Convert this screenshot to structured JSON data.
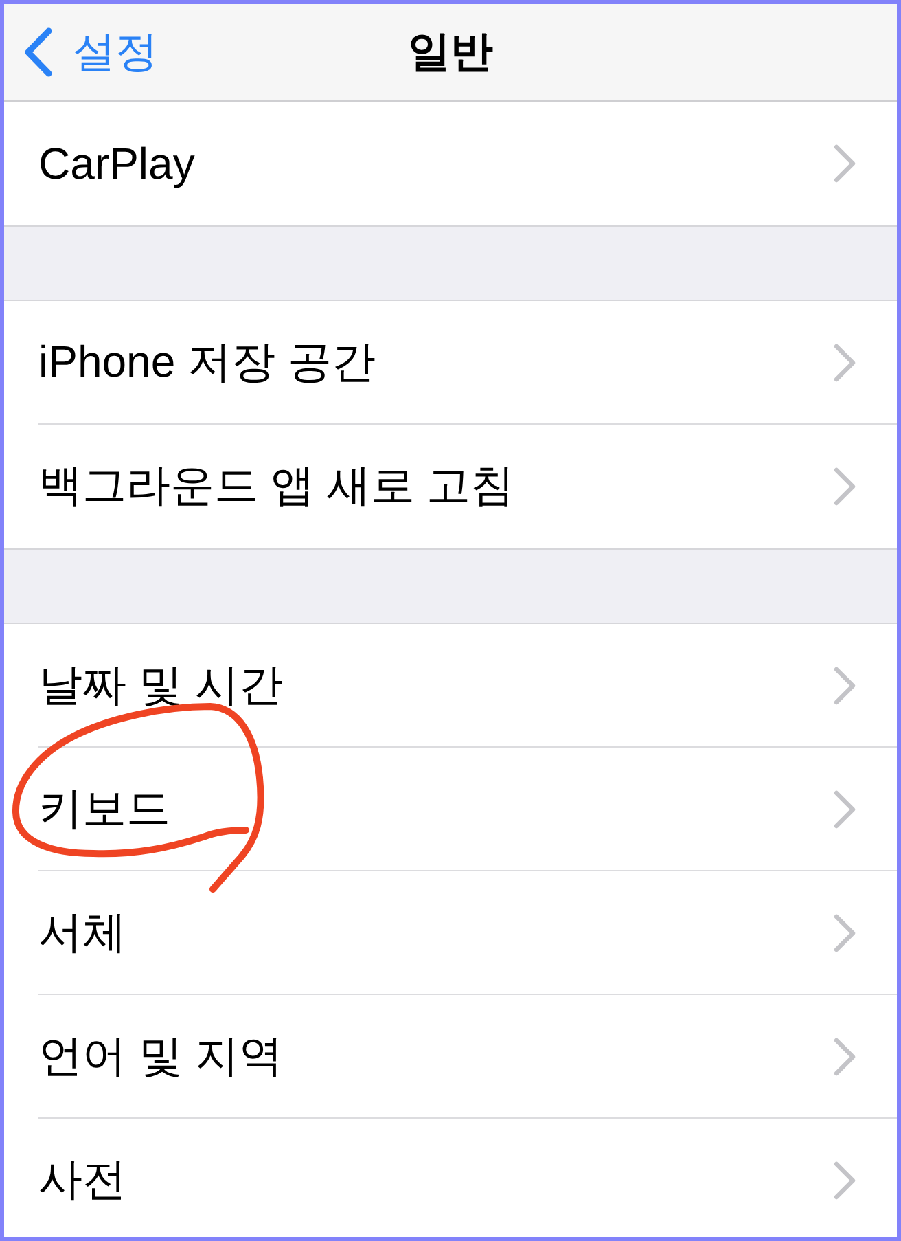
{
  "nav_bar": {
    "back_label": "설정",
    "title": "일반"
  },
  "groups": [
    {
      "items": [
        {
          "label": "CarPlay",
          "circled": false
        }
      ]
    },
    {
      "items": [
        {
          "label": "iPhone 저장 공간",
          "circled": false
        },
        {
          "label": "백그라운드 앱 새로 고침",
          "circled": false
        }
      ]
    },
    {
      "items": [
        {
          "label": "날짜 및 시간",
          "circled": false
        },
        {
          "label": "키보드",
          "circled": true
        },
        {
          "label": "서체",
          "circled": false
        },
        {
          "label": "언어 및 지역",
          "circled": false
        },
        {
          "label": "사전",
          "circled": false
        }
      ]
    }
  ]
}
